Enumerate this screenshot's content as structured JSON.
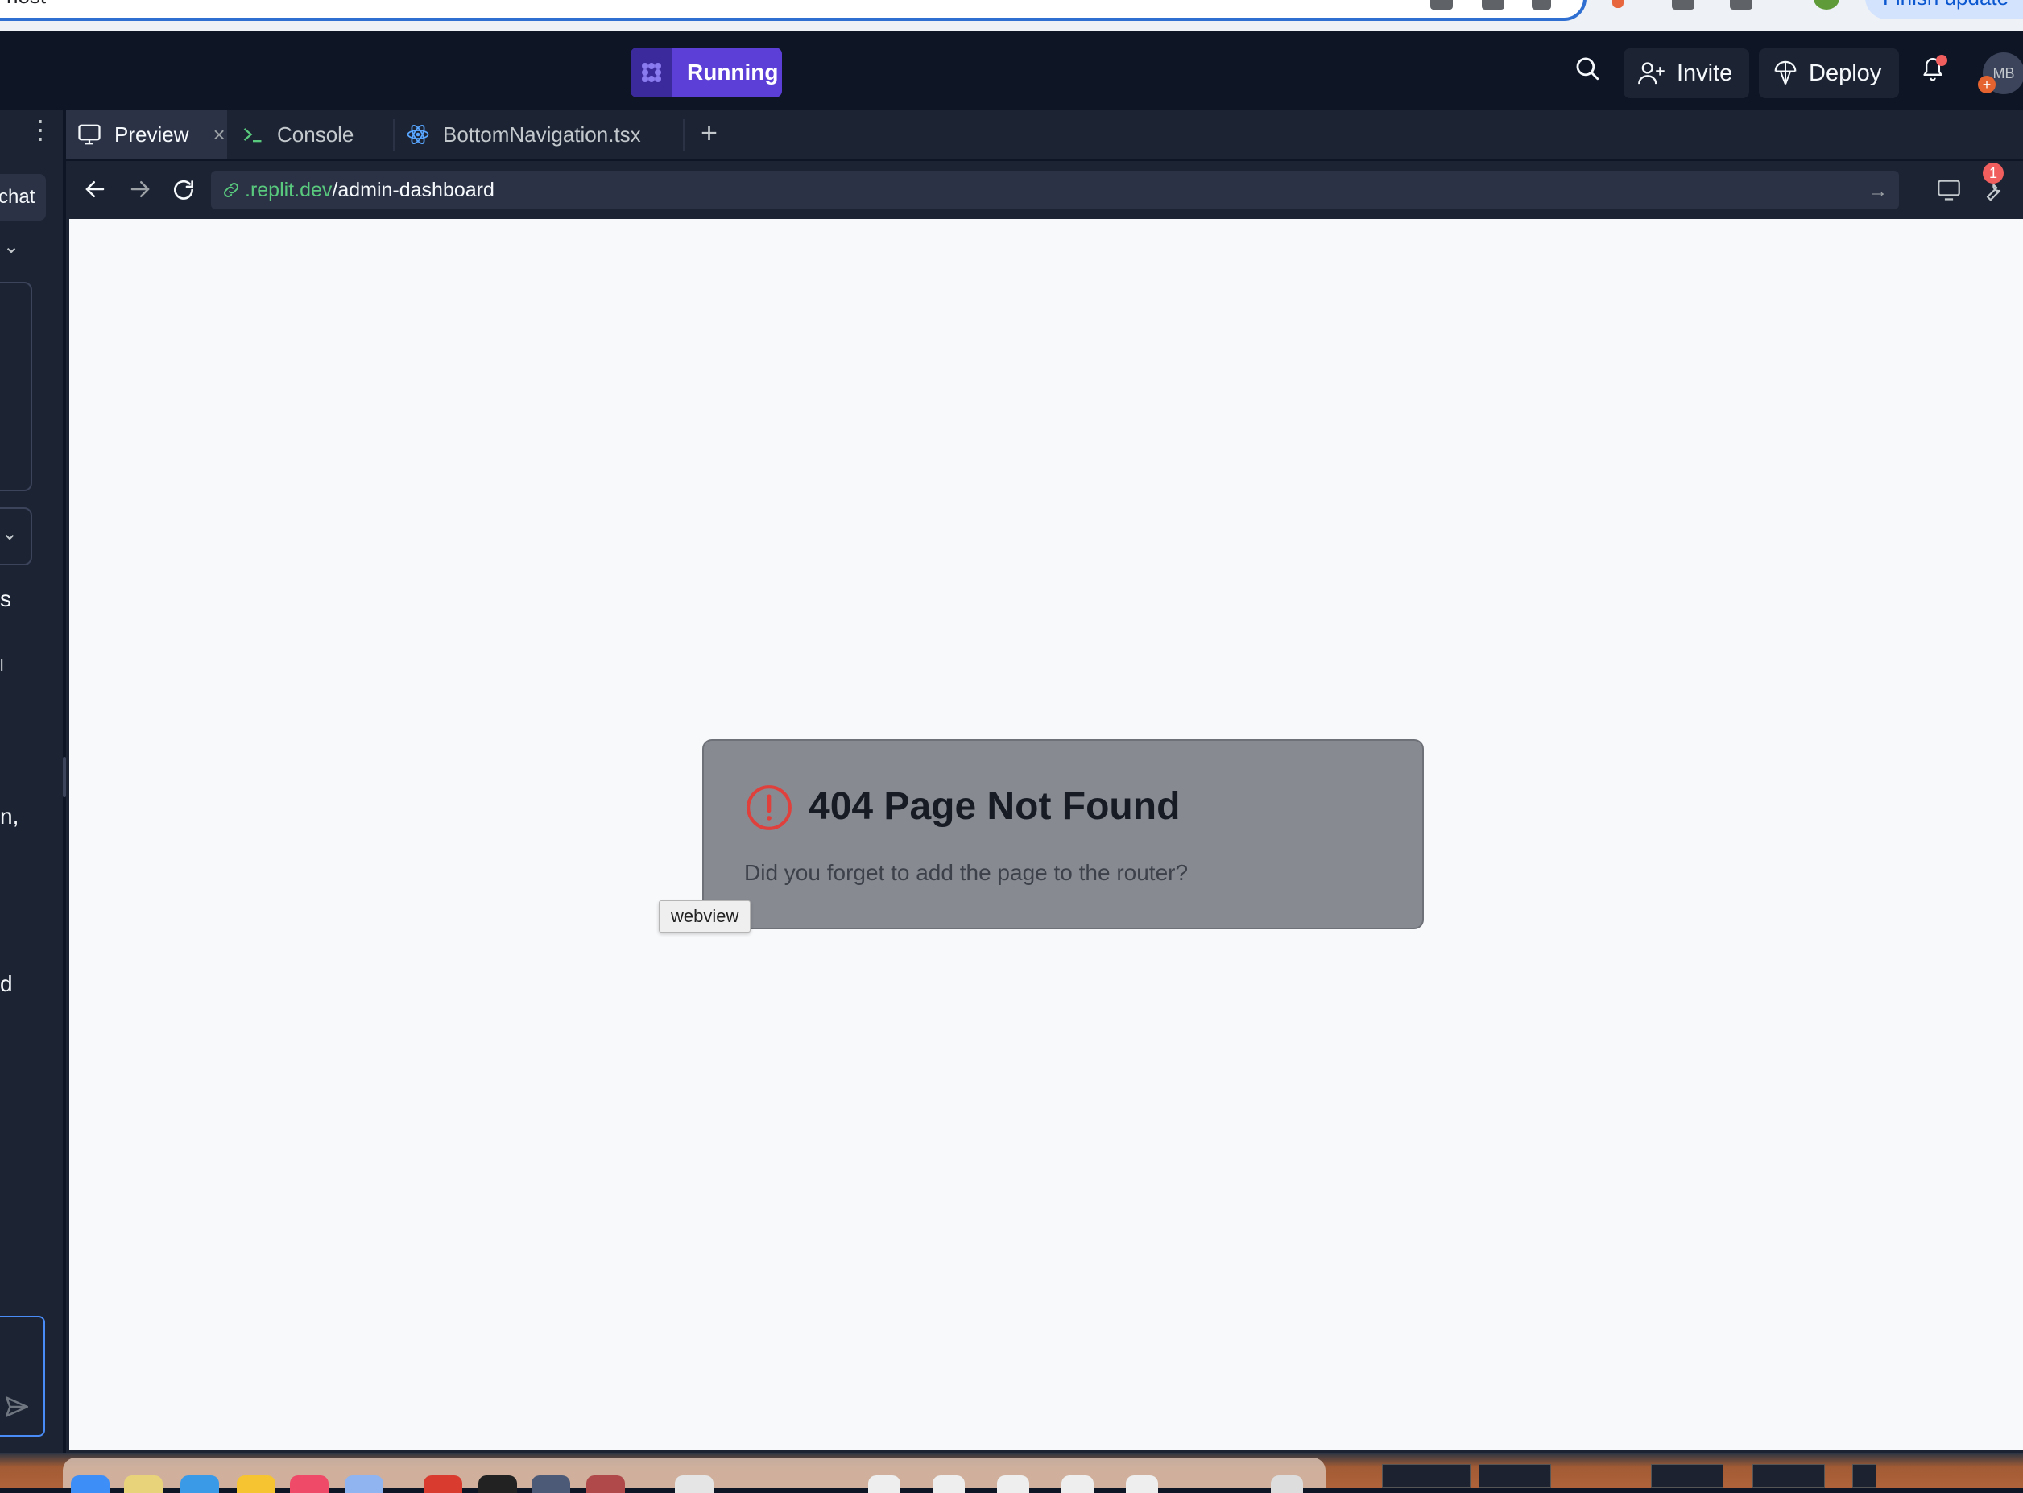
{
  "browser": {
    "omnibox_text": "host",
    "update_button": "Finish update"
  },
  "header": {
    "run_status": "Running",
    "invite_label": "Invite",
    "deploy_label": "Deploy",
    "avatar_initials": "MB"
  },
  "left_panel": {
    "new_chat_fragment": "chat",
    "text_fragments": [
      "s",
      "l",
      "n,",
      "d"
    ]
  },
  "tabs": [
    {
      "label": "Preview",
      "icon": "monitor-icon",
      "active": true
    },
    {
      "label": "Console",
      "icon": "terminal-icon",
      "active": false
    },
    {
      "label": "BottomNavigation.tsx",
      "icon": "react-icon",
      "active": false
    }
  ],
  "url": {
    "host": ".replit.dev",
    "path": "/admin-dashboard"
  },
  "devtools_badge": "1",
  "page": {
    "title": "404 Page Not Found",
    "message": "Did you forget to add the page to the router?",
    "tooltip": "webview"
  },
  "colors": {
    "run_button": "#5b3fd6",
    "error_icon": "#e0403c",
    "url_host": "#58c97d",
    "background": "#0e1525"
  }
}
